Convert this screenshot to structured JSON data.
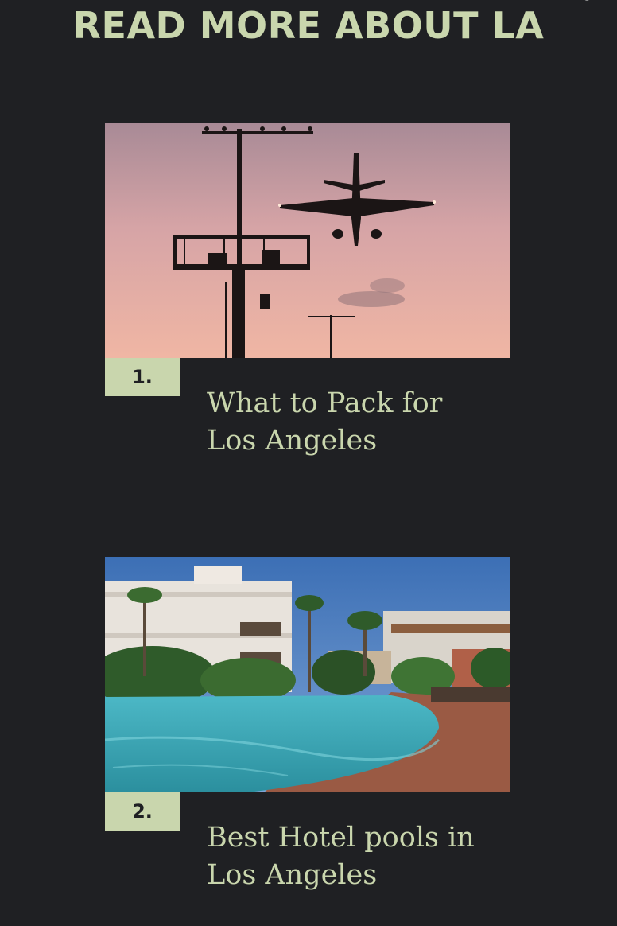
{
  "section": {
    "title": "READ MORE ABOUT LA"
  },
  "articles": [
    {
      "number": "1.",
      "title": "What to Pack for Los Angeles",
      "image_icon": "airplane-photo"
    },
    {
      "number": "2.",
      "title": "Best Hotel pools in Los Angeles",
      "image_icon": "hotel-pool-photo"
    }
  ],
  "colors": {
    "background": "#1f2023",
    "accent": "#c9d6ad"
  }
}
